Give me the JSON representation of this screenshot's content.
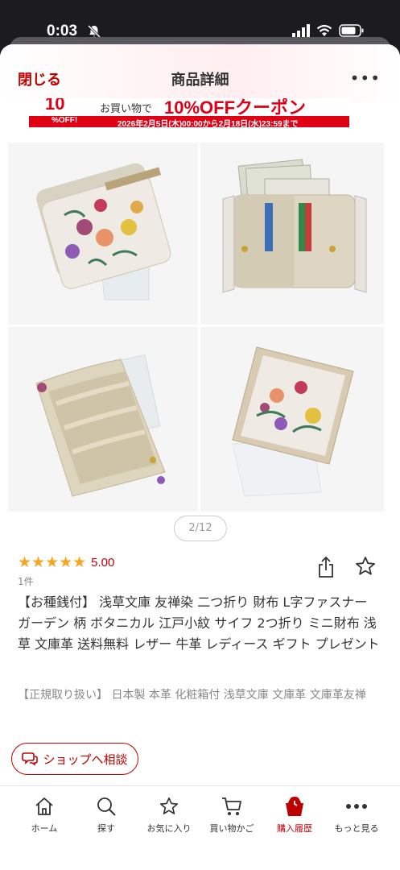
{
  "status_bar": {
    "time": "0:03"
  },
  "nav": {
    "close": "閉じる",
    "title": "商品詳細",
    "more": "•••"
  },
  "banner": {
    "big_number": "10",
    "off_label": "%OFF!",
    "lead": "お買い物で",
    "coupon": "10%OFFクーポン",
    "period": "2026年2月5日(木)00:00から2月18日(水)23:59まで"
  },
  "gallery": {
    "pager": "2/12"
  },
  "product": {
    "rating_value": "5.00",
    "rating_stars": 5,
    "review_count": "1件",
    "title": "【お種銭付】 浅草文庫 友禅染 二つ折り 財布 L字ファスナー ガーデン 柄 ボタニカル 江戸小紋 サイフ 2つ折り ミニ財布 浅草 文庫革 送料無料 レザー 牛革 レディース ギフト プレゼント",
    "subtitle": "【正規取り扱い】 日本製 本革 化粧箱付 浅草文庫 文庫革 文庫革友禅"
  },
  "consult_button": "ショップへ相談",
  "tabbar": {
    "items": [
      {
        "label": "ホーム",
        "icon": "home-icon"
      },
      {
        "label": "探す",
        "icon": "search-icon"
      },
      {
        "label": "お気に入り",
        "icon": "star-icon"
      },
      {
        "label": "買い物かご",
        "icon": "cart-icon"
      },
      {
        "label": "購入履歴",
        "icon": "purchase-history-icon",
        "active": true
      },
      {
        "label": "もっと見る",
        "icon": "more-icon"
      }
    ]
  },
  "colors": {
    "accent": "#bf0000",
    "star": "#f5a623",
    "banner": "#e00015"
  }
}
